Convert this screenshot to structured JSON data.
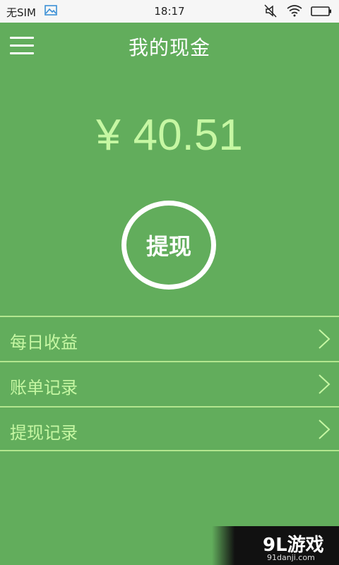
{
  "status_bar": {
    "carrier": "无SIM",
    "time": "18:17",
    "icons": [
      "image-icon",
      "mute-icon",
      "wifi-icon",
      "battery-icon"
    ]
  },
  "header": {
    "title": "我的现金",
    "menu_icon": "hamburger-menu-icon"
  },
  "balance": {
    "currency": "¥",
    "amount": "40.51"
  },
  "withdraw_button": {
    "label": "提现"
  },
  "menu_list": [
    {
      "label": "每日收益",
      "icon": "chevron-right-icon"
    },
    {
      "label": "账单记录",
      "icon": "chevron-right-icon"
    },
    {
      "label": "提现记录",
      "icon": "chevron-right-icon"
    }
  ],
  "watermark": {
    "logo": "9L游戏",
    "domain": "91danji.com"
  },
  "colors": {
    "background": "#62ad5c",
    "accent_text": "#c6f7a3",
    "divider": "#b3e68f",
    "white": "#ffffff"
  }
}
